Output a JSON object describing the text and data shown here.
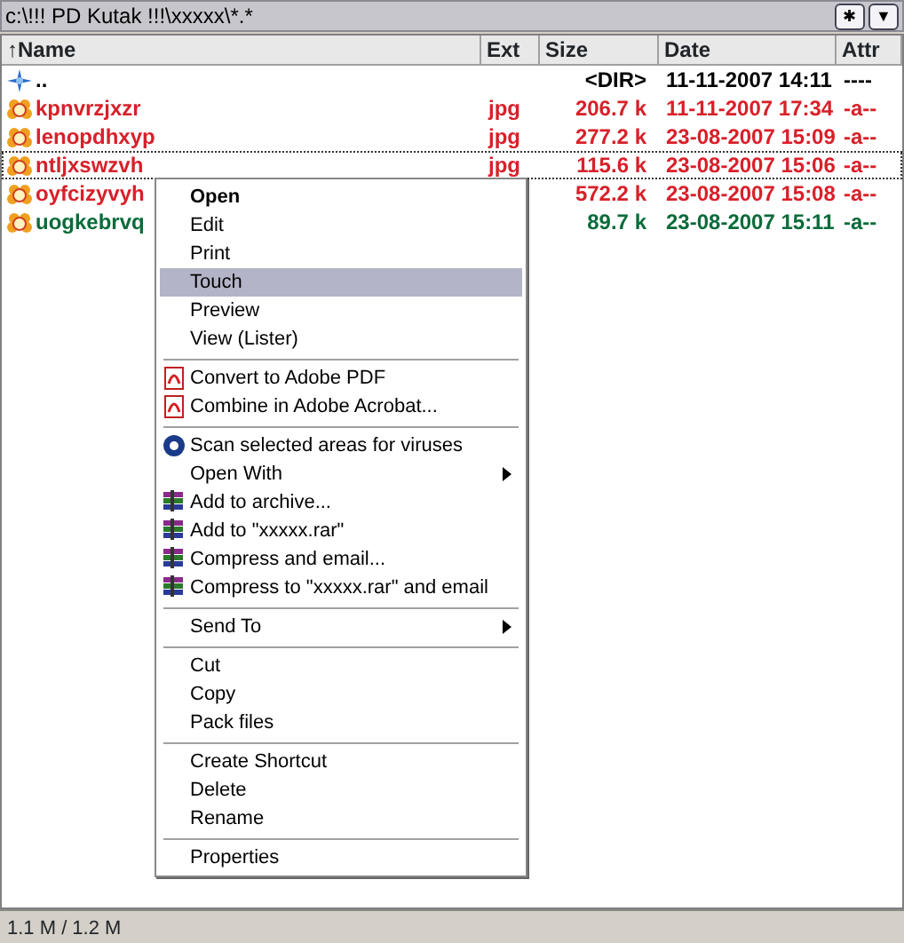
{
  "path_bar": {
    "path": "c:\\!!! PD Kutak !!!\\xxxxx\\*.*",
    "buttons": [
      "✱",
      "▼"
    ]
  },
  "columns": [
    "↑Name",
    "Ext",
    "Size",
    "Date",
    "Attr"
  ],
  "files": [
    {
      "kind": "dir",
      "name": "..",
      "size": "<DIR>",
      "date": "11-11-2007 14:11",
      "attr": "----",
      "color": "#000000",
      "focused": false
    },
    {
      "kind": "file",
      "name": "kpnvrzjxzr",
      "ext": "jpg",
      "size": "206.7 k",
      "date": "11-11-2007 17:34",
      "attr": "-a--",
      "color": "#d8202a",
      "focused": false
    },
    {
      "kind": "file",
      "name": "lenopdhxyp",
      "ext": "jpg",
      "size": "277.2 k",
      "date": "23-08-2007 15:09",
      "attr": "-a--",
      "color": "#d8202a",
      "focused": false
    },
    {
      "kind": "file",
      "name": "ntljxswzvh",
      "ext": "jpg",
      "size": "115.6 k",
      "date": "23-08-2007 15:06",
      "attr": "-a--",
      "color": "#d8202a",
      "focused": true
    },
    {
      "kind": "file",
      "name": "oyfcizyvyh",
      "size": "572.2 k",
      "date": "23-08-2007 15:08",
      "attr": "-a--",
      "color": "#d8202a",
      "focused": false
    },
    {
      "kind": "file",
      "name": "uogkebrvq",
      "size": "89.7 k",
      "date": "23-08-2007 15:11",
      "attr": "-a--",
      "color": "#0b6b3a",
      "focused": false
    }
  ],
  "status_bar": "1.1 M / 1.2 M",
  "context_menu": [
    [
      {
        "label": "Open",
        "kind": "plain",
        "default": true,
        "selected": false,
        "submenu": false
      },
      {
        "label": "Edit",
        "kind": "plain",
        "default": false,
        "selected": false,
        "submenu": false
      },
      {
        "label": "Print",
        "kind": "plain",
        "default": false,
        "selected": false,
        "submenu": false
      },
      {
        "label": "Touch",
        "kind": "plain",
        "default": false,
        "selected": true,
        "submenu": false
      },
      {
        "label": "Preview",
        "kind": "plain",
        "default": false,
        "selected": false,
        "submenu": false
      },
      {
        "label": "View (Lister)",
        "kind": "plain",
        "default": false,
        "selected": false,
        "submenu": false
      }
    ],
    [
      {
        "label": "Convert to Adobe PDF",
        "kind": "pdf",
        "default": false,
        "selected": false,
        "submenu": false
      },
      {
        "label": "Combine in Adobe Acrobat...",
        "kind": "pdf",
        "default": false,
        "selected": false,
        "submenu": false
      }
    ],
    [
      {
        "label": "Scan selected areas for viruses",
        "kind": "scan",
        "default": false,
        "selected": false,
        "submenu": false
      },
      {
        "label": "Open With",
        "kind": "plain",
        "default": false,
        "selected": false,
        "submenu": true
      },
      {
        "label": "Add to archive...",
        "kind": "archive",
        "default": false,
        "selected": false,
        "submenu": false
      },
      {
        "label": "Add to \"xxxxx.rar\"",
        "kind": "archive",
        "default": false,
        "selected": false,
        "submenu": false
      },
      {
        "label": "Compress and email...",
        "kind": "archive",
        "default": false,
        "selected": false,
        "submenu": false
      },
      {
        "label": "Compress to \"xxxxx.rar\" and email",
        "kind": "archive",
        "default": false,
        "selected": false,
        "submenu": false
      }
    ],
    [
      {
        "label": "Send To",
        "kind": "plain",
        "default": false,
        "selected": false,
        "submenu": true
      }
    ],
    [
      {
        "label": "Cut",
        "kind": "plain",
        "default": false,
        "selected": false,
        "submenu": false
      },
      {
        "label": "Copy",
        "kind": "plain",
        "default": false,
        "selected": false,
        "submenu": false
      },
      {
        "label": "Pack files",
        "kind": "plain",
        "default": false,
        "selected": false,
        "submenu": false
      }
    ],
    [
      {
        "label": "Create Shortcut",
        "kind": "plain",
        "default": false,
        "selected": false,
        "submenu": false
      },
      {
        "label": "Delete",
        "kind": "plain",
        "default": false,
        "selected": false,
        "submenu": false
      },
      {
        "label": "Rename",
        "kind": "plain",
        "default": false,
        "selected": false,
        "submenu": false
      }
    ],
    [
      {
        "label": "Properties",
        "kind": "plain",
        "default": false,
        "selected": false,
        "submenu": false
      }
    ]
  ]
}
